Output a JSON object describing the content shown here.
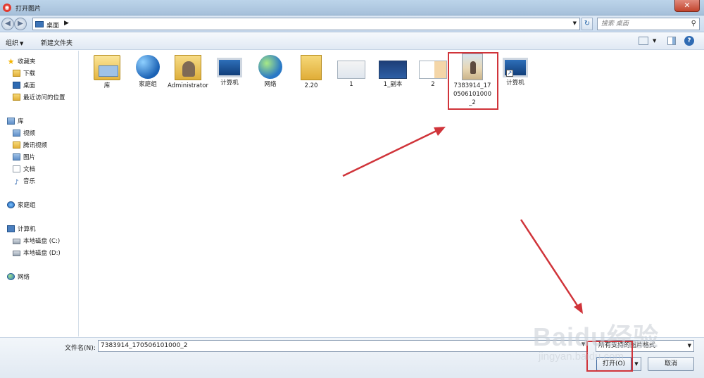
{
  "window": {
    "title": "打开图片",
    "close_glyph": "✕"
  },
  "nav": {
    "back_glyph": "◀",
    "forward_glyph": "▶",
    "address_text": "桌面",
    "address_chevron": "▶",
    "refresh_glyph": "↻",
    "search_placeholder": "搜索 桌面"
  },
  "toolbar": {
    "organize_label": "组织",
    "new_folder_label": "新建文件夹",
    "help_glyph": "?"
  },
  "sidebar": {
    "favorites": {
      "label": "收藏夹",
      "items": [
        {
          "label": "下载"
        },
        {
          "label": "桌面"
        },
        {
          "label": "最近访问的位置"
        }
      ]
    },
    "libraries": {
      "label": "库",
      "items": [
        {
          "label": "视频"
        },
        {
          "label": "腾讯视频"
        },
        {
          "label": "图片"
        },
        {
          "label": "文档"
        },
        {
          "label": "音乐"
        }
      ]
    },
    "homegroup": {
      "label": "家庭组"
    },
    "computer": {
      "label": "计算机",
      "items": [
        {
          "label": "本地磁盘 (C:)"
        },
        {
          "label": "本地磁盘 (D:)"
        }
      ]
    },
    "network": {
      "label": "网络"
    }
  },
  "files": [
    {
      "label": "库",
      "icon": "library-icon"
    },
    {
      "label": "家庭组",
      "icon": "homegroup-icon"
    },
    {
      "label": "Administrator",
      "icon": "user-folder-icon"
    },
    {
      "label": "计算机",
      "icon": "computer-icon"
    },
    {
      "label": "网络",
      "icon": "network-icon"
    },
    {
      "label": "2.20",
      "icon": "folder-icon"
    },
    {
      "label": "1",
      "icon": "image-thumbnail"
    },
    {
      "label": "1_副本",
      "icon": "image-thumbnail"
    },
    {
      "label": "2",
      "icon": "image-thumbnail"
    },
    {
      "label": "7383914_170506101000_2",
      "icon": "photo-thumbnail",
      "selected": true
    },
    {
      "label": "计算机",
      "icon": "computer-shortcut-icon"
    }
  ],
  "footer": {
    "filename_label": "文件名(N):",
    "filename_value": "7383914_170506101000_2",
    "filter_value": "所有支持的图片格式",
    "open_label": "打开(O)",
    "cancel_label": "取消"
  },
  "watermark": {
    "brand": "Baidu经验",
    "sub": "jingyan.baidu.com"
  },
  "colors": {
    "highlight": "#d0343a",
    "accent": "#3c74b8"
  }
}
